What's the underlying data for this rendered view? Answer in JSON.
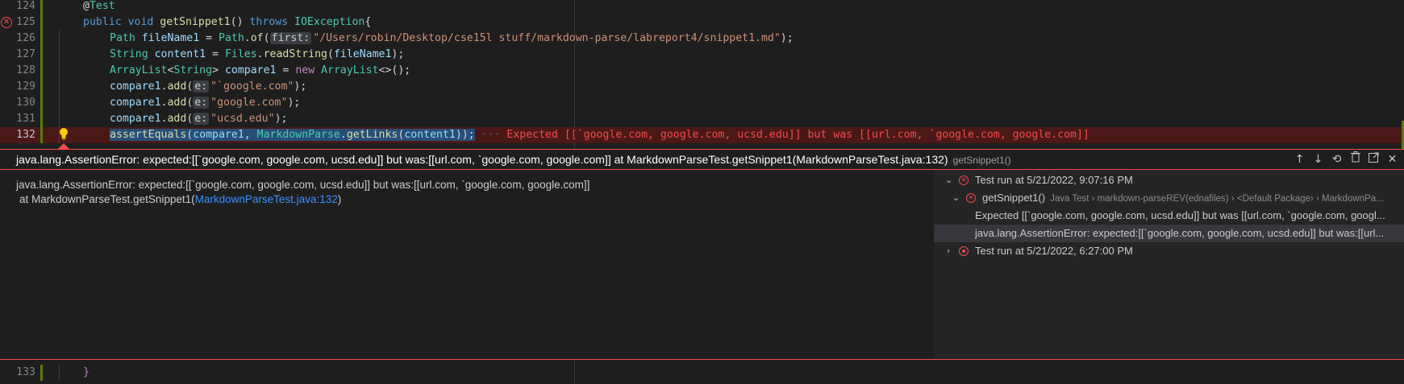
{
  "editor": {
    "lines": [
      {
        "num": "124",
        "tokens": [
          [
            "punc",
            "@"
          ],
          [
            "type",
            "Test"
          ]
        ],
        "indent": 1
      },
      {
        "num": "125",
        "tokens": [
          [
            "kw",
            "public "
          ],
          [
            "kw",
            "void "
          ],
          [
            "fn",
            "getSnippet1"
          ],
          [
            "punc",
            "() "
          ],
          [
            "kw",
            "throws "
          ],
          [
            "type",
            "IOException"
          ],
          [
            "punc",
            "{"
          ]
        ],
        "indent": 1,
        "error": true
      },
      {
        "num": "126",
        "tokens": [
          [
            "type",
            "Path "
          ],
          [
            "var",
            "fileName1"
          ],
          [
            "punc",
            " = "
          ],
          [
            "type",
            "Path"
          ],
          [
            "punc",
            "."
          ],
          [
            "fn",
            "of"
          ],
          [
            "punc",
            "("
          ],
          [
            "hint",
            "first:"
          ],
          [
            "str",
            "\"/Users/robin/Desktop/cse15l stuff/markdown-parse/labreport4/snippet1.md\""
          ],
          [
            "punc",
            ");"
          ]
        ],
        "indent": 2
      },
      {
        "num": "127",
        "tokens": [
          [
            "type",
            "String "
          ],
          [
            "var",
            "content1"
          ],
          [
            "punc",
            " = "
          ],
          [
            "type",
            "Files"
          ],
          [
            "punc",
            "."
          ],
          [
            "fn",
            "readString"
          ],
          [
            "punc",
            "("
          ],
          [
            "var",
            "fileName1"
          ],
          [
            "punc",
            ");"
          ]
        ],
        "indent": 2
      },
      {
        "num": "128",
        "tokens": [
          [
            "type",
            "ArrayList"
          ],
          [
            "punc",
            "<"
          ],
          [
            "type",
            "String"
          ],
          [
            "punc",
            "> "
          ],
          [
            "var",
            "compare1"
          ],
          [
            "punc",
            " = "
          ],
          [
            "kw2",
            "new "
          ],
          [
            "type",
            "ArrayList"
          ],
          [
            "punc",
            "<>();"
          ]
        ],
        "indent": 2
      },
      {
        "num": "129",
        "tokens": [
          [
            "var",
            "compare1"
          ],
          [
            "punc",
            "."
          ],
          [
            "fn",
            "add"
          ],
          [
            "punc",
            "("
          ],
          [
            "hint",
            "e:"
          ],
          [
            "str",
            "\"`google.com\""
          ],
          [
            "punc",
            ");"
          ]
        ],
        "indent": 2
      },
      {
        "num": "130",
        "tokens": [
          [
            "var",
            "compare1"
          ],
          [
            "punc",
            "."
          ],
          [
            "fn",
            "add"
          ],
          [
            "punc",
            "("
          ],
          [
            "hint",
            "e:"
          ],
          [
            "str",
            "\"google.com\""
          ],
          [
            "punc",
            ");"
          ]
        ],
        "indent": 2
      },
      {
        "num": "131",
        "tokens": [
          [
            "var",
            "compare1"
          ],
          [
            "punc",
            "."
          ],
          [
            "fn",
            "add"
          ],
          [
            "punc",
            "("
          ],
          [
            "hint",
            "e:"
          ],
          [
            "str",
            "\"ucsd.edu\""
          ],
          [
            "punc",
            ");"
          ]
        ],
        "indent": 2
      },
      {
        "num": "132",
        "tokens": [
          [
            "fn",
            "assertEquals"
          ],
          [
            "punc",
            "("
          ],
          [
            "var",
            "compare1"
          ],
          [
            "punc",
            ", "
          ],
          [
            "type",
            "MarkdownParse"
          ],
          [
            "punc",
            "."
          ],
          [
            "fn",
            "getLinks"
          ],
          [
            "punc",
            "("
          ],
          [
            "var",
            "content1"
          ],
          [
            "punc",
            "));"
          ]
        ],
        "indent": 2,
        "active": true,
        "inline_error": "Expected [[`google.com, google.com, ucsd.edu]] but was [[url.com, `google.com, google.com]]"
      }
    ],
    "after_line": {
      "num": "133",
      "text": "}"
    }
  },
  "peek": {
    "title": "java.lang.AssertionError: expected:[[`google.com, google.com, ucsd.edu]] but was:[[url.com, `google.com, google.com]] at MarkdownParseTest.getSnippet1(MarkdownParseTest.java:132)",
    "subtitle": "getSnippet1()",
    "message_line1": "java.lang.AssertionError: expected:[[`google.com, google.com, ucsd.edu]] but was:[[url.com, `google.com, google.com]]",
    "message_line2_prefix": " at MarkdownParseTest.getSnippet1(",
    "message_line2_link": "MarkdownParseTest.java:132",
    "message_line2_suffix": ")",
    "actions": [
      "arrow-up-icon",
      "arrow-down-icon",
      "history-icon",
      "trash-icon",
      "open-external-icon",
      "close-icon"
    ]
  },
  "test_tree": {
    "run1": "Test run at 5/21/2022, 9:07:16 PM",
    "test_name": "getSnippet1()",
    "test_path": "Java Test › markdown-parseREV(ednafiles) › <Default Package› › MarkdownPa...",
    "msg_expected": "Expected [[`google.com, google.com, ucsd.edu]] but was [[url.com, `google.com, googl...",
    "msg_assert": "java.lang.AssertionError: expected:[[`google.com, google.com, ucsd.edu]] but was:[[url...",
    "run2": "Test run at 5/21/2022, 6:27:00 PM"
  },
  "colors": {
    "error": "#f14c4c",
    "git_added": "#587c0c",
    "link": "#3794ff"
  }
}
